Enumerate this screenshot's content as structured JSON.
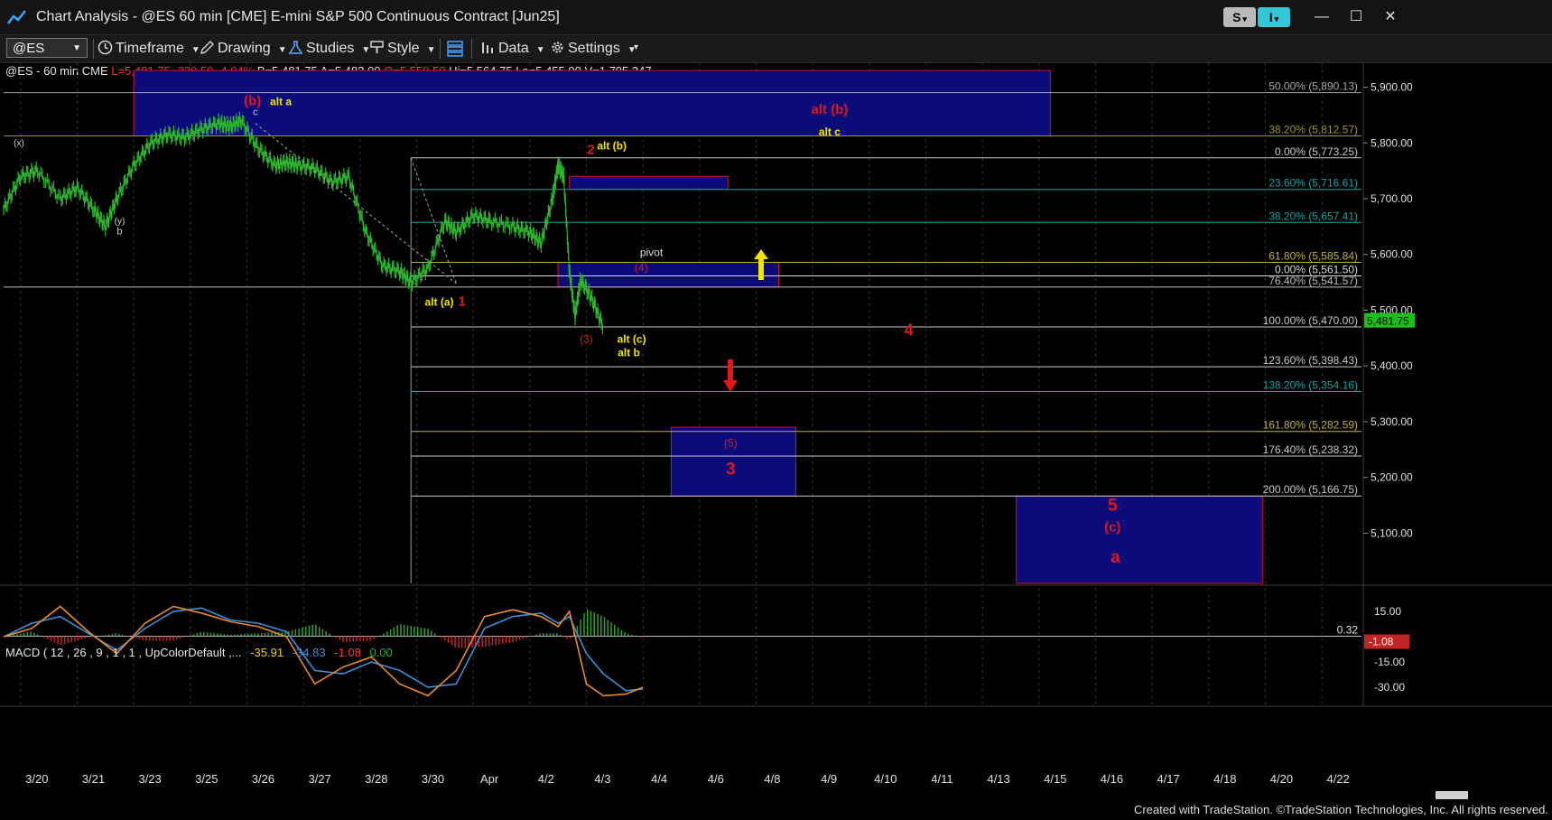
{
  "window": {
    "title": "Chart Analysis - @ES 60 min [CME] E-mini S&P 500 Continuous Contract [Jun25]",
    "s_button": "S",
    "i_button": "I",
    "minimize": "—",
    "maximize": "☐",
    "close": "✕"
  },
  "toolbar": {
    "symbol": "@ES",
    "items": [
      "Timeframe",
      "Drawing",
      "Studies",
      "Style",
      "Data",
      "Settings"
    ]
  },
  "info": {
    "prefix": "@ES - 60 min  CME",
    "last": "L=5,481.75",
    "change": "-230.50",
    "pct": "-4.04%",
    "bid": "B=5,481.75",
    "ask": "A=5,482.00",
    "open": "O=5,550.50",
    "high": "Hi=5,564.75",
    "low": "Lo=5,455.00",
    "volume": "V=1,705,347"
  },
  "macd": {
    "label": "MACD ( 12 , 26 , 9 , 1 , 1 , UpColorDefault ,...",
    "v1": "-35.91",
    "v2": "-34.83",
    "v3": "-1.08",
    "v4": "0.00",
    "ref_label": "0.32",
    "current_tag": "-1.08"
  },
  "colors": {
    "bars": "#2db52d",
    "macd_line": "#3a8fd6",
    "signal_line": "#e8892a",
    "hist_pos": "#2fa02f",
    "hist_neg": "#c02424",
    "zone_fill": "#0b0b7a",
    "zone_border": "#d01515",
    "wave_red": "#e01818",
    "wave_yellow": "#f2e600",
    "price_tag": "#18c018"
  },
  "chart_data": [
    {
      "type": "line",
      "subtype": "ohlc-bars",
      "x_axis_labels": [
        "3/20",
        "3/21",
        "3/23",
        "3/25",
        "3/26",
        "3/27",
        "3/28",
        "3/30",
        "Apr",
        "4/2",
        "4/3",
        "4/4",
        "4/6",
        "4/8",
        "4/9",
        "4/10",
        "4/11",
        "4/13",
        "4/15",
        "4/16",
        "4/17",
        "4/18",
        "4/20",
        "4/22"
      ],
      "y_axis_ticks": [
        5100,
        5200,
        5300,
        5400,
        5500,
        5600,
        5700,
        5800,
        5900
      ],
      "y_axis_tick_labels": [
        "5,100.00",
        "5,200.00",
        "5,300.00",
        "5,400.00",
        "5,500.00",
        "5,600.00",
        "5,700.00",
        "5,800.00",
        "5,900.00"
      ],
      "ylim": [
        5010,
        5930
      ],
      "x_index_range": [
        0,
        24
      ],
      "last_price": 5481.75,
      "last_price_label": "5,481.75",
      "series": [
        {
          "x": [
            0,
            0.3,
            0.6,
            1.0,
            1.3,
            1.6,
            1.8,
            2.0,
            2.3,
            2.6,
            2.9,
            3.2,
            3.5,
            3.8,
            4.0,
            4.2,
            4.5,
            4.8,
            5.0,
            5.2,
            5.5,
            5.8,
            6.1,
            6.4,
            6.7,
            7.0,
            7.2,
            7.5,
            7.8,
            8.0,
            8.3,
            8.6,
            9.0,
            9.3,
            9.5,
            9.7,
            9.8,
            9.9,
            10.0,
            10.1,
            10.2,
            10.4,
            10.6
          ],
          "values": [
            5680,
            5740,
            5750,
            5700,
            5720,
            5680,
            5650,
            5700,
            5760,
            5800,
            5815,
            5810,
            5825,
            5835,
            5830,
            5840,
            5790,
            5760,
            5765,
            5760,
            5755,
            5730,
            5740,
            5640,
            5580,
            5570,
            5550,
            5575,
            5660,
            5640,
            5670,
            5660,
            5650,
            5640,
            5620,
            5700,
            5760,
            5740,
            5570,
            5490,
            5555,
            5520,
            5470
          ]
        }
      ],
      "fib_levels": [
        {
          "pct": "50.00%",
          "price": 5890.13,
          "label": "50.00% (5,890.13)",
          "color": "#a8a8a8"
        },
        {
          "pct": "38.20%",
          "price": 5812.57,
          "label": "38.20% (5,812.57)",
          "color": "#9c9430"
        },
        {
          "pct": "0.00%",
          "price": 5773.25,
          "label": "0.00% (5,773.25)",
          "color": "#c8c8c8"
        },
        {
          "pct": "23.60%",
          "price": 5716.61,
          "label": "23.60% (5,716.61)",
          "color": "#1aa0a0"
        },
        {
          "pct": "38.20%",
          "price": 5657.41,
          "label": "38.20% (5,657.41)",
          "color": "#1aa0a0"
        },
        {
          "pct": "61.80%",
          "price": 5585.84,
          "label": "61.80% (5,585.84)",
          "color": "#bfb040"
        },
        {
          "pct": "0.00%",
          "price": 5561.5,
          "label": "0.00% (5,561.50)",
          "color": "#d8d8d8"
        },
        {
          "pct": "76.40%",
          "price": 5541.57,
          "label": "76.40% (5,541.57)",
          "color": "#bcbcbc"
        },
        {
          "pct": "100.00%",
          "price": 5470.0,
          "label": "100.00% (5,470.00)",
          "color": "#c8c8c8"
        },
        {
          "pct": "123.60%",
          "price": 5398.43,
          "label": "123.60% (5,398.43)",
          "color": "#c8c8c8"
        },
        {
          "pct": "138.20%",
          "price": 5354.16,
          "label": "138.20% (5,354.16)",
          "color": "#1aa0a0"
        },
        {
          "pct": "161.80%",
          "price": 5282.59,
          "label": "161.80% (5,282.59)",
          "color": "#bfb040"
        },
        {
          "pct": "176.40%",
          "price": 5238.32,
          "label": "176.40% (5,238.32)",
          "color": "#c8c8c8"
        },
        {
          "pct": "200.00%",
          "price": 5166.75,
          "label": "200.00% (5,166.75)",
          "color": "#c8c8c8"
        }
      ],
      "zones": [
        {
          "x0": 2.3,
          "x1": 18.5,
          "y0": 5812.57,
          "y1": 5930
        },
        {
          "x0": 10.0,
          "x1": 12.8,
          "y0": 5716.61,
          "y1": 5740
        },
        {
          "x0": 9.8,
          "x1": 13.7,
          "y0": 5541.57,
          "y1": 5585.84
        },
        {
          "x0": 11.8,
          "x1": 14.0,
          "y0": 5166.75,
          "y1": 5290
        },
        {
          "x0": 17.9,
          "x1": 22.25,
          "y0": 5010,
          "y1": 5166.75
        }
      ],
      "annotations": [
        {
          "text": "(x)",
          "x": 0.27,
          "price": 5795,
          "color": "#cfcfcf",
          "size": 10
        },
        {
          "text": "(y)",
          "x": 2.05,
          "price": 5655,
          "color": "#cfcfcf",
          "size": 10
        },
        {
          "text": "b",
          "x": 2.05,
          "price": 5636,
          "color": "#cfcfcf",
          "size": 11
        },
        {
          "text": "(b)",
          "x": 4.4,
          "price": 5868,
          "color": "#e01818",
          "size": 15,
          "bold": true
        },
        {
          "text": "alt a",
          "x": 4.9,
          "price": 5868,
          "color": "#f2e600",
          "size": 12,
          "bold": true
        },
        {
          "text": "c",
          "x": 4.45,
          "price": 5850,
          "color": "#cfcfcf",
          "size": 11
        },
        {
          "text": "alt (b)",
          "x": 14.6,
          "price": 5852,
          "color": "#e01818",
          "size": 15,
          "bold": true
        },
        {
          "text": "alt c",
          "x": 14.6,
          "price": 5813,
          "color": "#f2e600",
          "size": 12,
          "bold": true
        },
        {
          "text": "2",
          "x": 10.38,
          "price": 5780,
          "color": "#e01818",
          "size": 15,
          "bold": true
        },
        {
          "text": "alt (b)",
          "x": 10.75,
          "price": 5788,
          "color": "#f2e600",
          "size": 12,
          "bold": true
        },
        {
          "text": "pivot",
          "x": 11.45,
          "price": 5597,
          "color": "#dcdcdc",
          "size": 12
        },
        {
          "text": "(4)",
          "x": 11.27,
          "price": 5570,
          "color": "#e01818",
          "size": 12
        },
        {
          "text": "alt (a)",
          "x": 7.7,
          "price": 5508,
          "color": "#f2e600",
          "size": 12,
          "bold": true
        },
        {
          "text": "1",
          "x": 8.1,
          "price": 5508,
          "color": "#e01818",
          "size": 15,
          "bold": true
        },
        {
          "text": "(3)",
          "x": 10.3,
          "price": 5442,
          "color": "#e01818",
          "size": 12
        },
        {
          "text": "alt (c)",
          "x": 11.1,
          "price": 5442,
          "color": "#f2e600",
          "size": 12,
          "bold": true
        },
        {
          "text": "alt b",
          "x": 11.05,
          "price": 5417,
          "color": "#f2e600",
          "size": 12,
          "bold": true
        },
        {
          "text": "4",
          "x": 16.0,
          "price": 5455,
          "color": "#e01818",
          "size": 18,
          "bold": true
        },
        {
          "text": "(5)",
          "x": 12.85,
          "price": 5255,
          "color": "#e01818",
          "size": 12
        },
        {
          "text": "3",
          "x": 12.85,
          "price": 5205,
          "color": "#e01818",
          "size": 19,
          "bold": true
        },
        {
          "text": "5",
          "x": 19.6,
          "price": 5140,
          "color": "#e01818",
          "size": 19,
          "bold": true
        },
        {
          "text": "(c)",
          "x": 19.6,
          "price": 5103,
          "color": "#e01818",
          "size": 15,
          "bold": true
        },
        {
          "text": "a",
          "x": 19.65,
          "price": 5047,
          "color": "#e01818",
          "size": 19,
          "bold": true
        }
      ]
    },
    {
      "type": "line",
      "subtype": "macd",
      "y_axis_ticks": [
        15,
        -15,
        -30
      ],
      "y_axis_tick_labels": [
        "15.00",
        "-15.00",
        "-30.00"
      ],
      "ylim": [
        -38,
        22
      ],
      "zero_ref": 0.32,
      "series": [
        {
          "name": "MACD",
          "x": [
            0,
            0.5,
            1.0,
            1.5,
            2.0,
            2.5,
            3.0,
            3.5,
            4.0,
            4.5,
            5.0,
            5.5,
            6.0,
            6.5,
            7.0,
            7.5,
            8.0,
            8.5,
            9.0,
            9.5,
            9.8,
            10.0,
            10.3,
            10.6,
            11.0,
            11.3
          ],
          "values": [
            0,
            8,
            12,
            2,
            -8,
            5,
            15,
            17,
            10,
            8,
            3,
            -20,
            -22,
            -15,
            -20,
            -30,
            -28,
            5,
            12,
            14,
            8,
            12,
            -10,
            -22,
            -32,
            -31
          ]
        },
        {
          "name": "Signal",
          "x": [
            0,
            0.5,
            1.0,
            1.5,
            2.0,
            2.5,
            3.0,
            3.5,
            4.0,
            4.5,
            5.0,
            5.5,
            6.0,
            6.5,
            7.0,
            7.5,
            8.0,
            8.5,
            9.0,
            9.5,
            9.8,
            10.0,
            10.3,
            10.6,
            11.0,
            11.3
          ],
          "values": [
            0,
            5,
            18,
            3,
            -10,
            8,
            18,
            14,
            9,
            6,
            0,
            -28,
            -18,
            -12,
            -28,
            -35,
            -20,
            12,
            16,
            12,
            6,
            15,
            -28,
            -35,
            -34,
            -30
          ]
        }
      ]
    }
  ],
  "credit": "Created with TradeStation. ©TradeStation Technologies, Inc. All rights reserved."
}
